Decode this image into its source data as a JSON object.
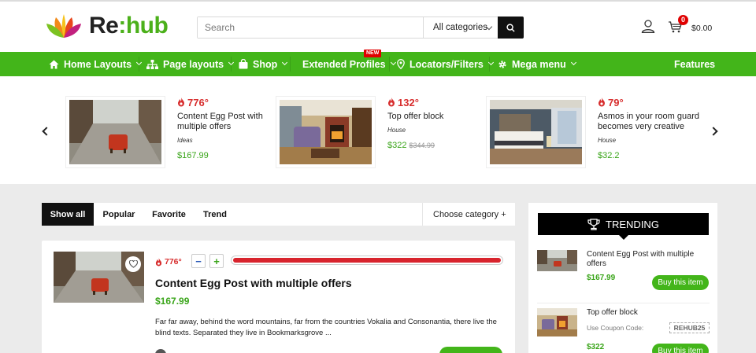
{
  "header": {
    "logo": {
      "prefix": "Re",
      "colon": ":",
      "suffix": "hub"
    },
    "search": {
      "placeholder": "Search",
      "category": "All categories"
    },
    "cart": {
      "count": "0",
      "total": "$0.00"
    }
  },
  "nav": {
    "items": [
      {
        "label": "Home Layouts",
        "icon": "home-icon"
      },
      {
        "label": "Page layouts",
        "icon": "sitemap-icon"
      },
      {
        "label": "Shop",
        "icon": "shopping-bag-icon"
      },
      {
        "label": "Extended Profiles",
        "badge": "NEW"
      },
      {
        "label": "Locators/Filters",
        "icon": "map-marker-icon"
      },
      {
        "label": "Mega menu",
        "icon": "gear-icon"
      },
      {
        "label": "Features"
      }
    ]
  },
  "carousel": {
    "slides": [
      {
        "hot": "776°",
        "title": "Content Egg Post with multiple offers",
        "category": "Ideas",
        "price": "$167.99",
        "old_price": ""
      },
      {
        "hot": "132°",
        "title": "Top offer block",
        "category": "House",
        "price": "$322",
        "old_price": "$344.99"
      },
      {
        "hot": "79°",
        "title": "Asmos in your room guard becomes very creative",
        "category": "House",
        "price": "$32.2",
        "old_price": ""
      }
    ]
  },
  "tabs": {
    "items": [
      "Show all",
      "Popular",
      "Favorite",
      "Trend"
    ],
    "choose": "Choose category +"
  },
  "post": {
    "hot": "776°",
    "minus": "−",
    "plus": "+",
    "hot_level": 1.0,
    "title": "Content Egg Post with multiple offers",
    "price": "$167.99",
    "description": "Far far away, behind the word mountains, far from the countries Vokalia and Consonantia, there live the blind texts. Separated they live in Bookmarksgrove ..."
  },
  "sidebar": {
    "heading": "TRENDING",
    "items": [
      {
        "title": "Content Egg Post with multiple offers",
        "price": "$167.99",
        "button": "Buy this item"
      },
      {
        "title": "Top offer block",
        "coupon_label": "Use Coupon Code:",
        "coupon_code": "REHUB25",
        "price": "$322",
        "button": "Buy this item"
      }
    ]
  },
  "colors": {
    "brand_green": "#43b51a",
    "hot_red": "#d72d2d",
    "price_green": "#3aa51a",
    "badge_red": "#e00000"
  }
}
